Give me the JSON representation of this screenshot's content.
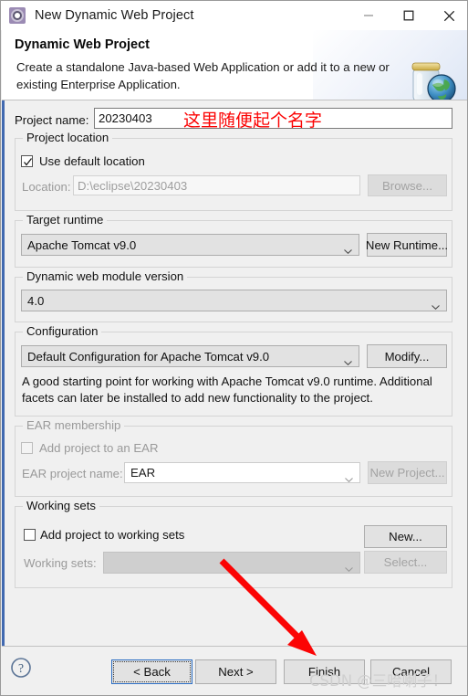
{
  "window": {
    "title": "New Dynamic Web Project",
    "icon": "eclipse-wizard-icon",
    "minimize_label": "—",
    "maximize_label": "□",
    "close_label": "✕"
  },
  "header": {
    "title": "Dynamic Web Project",
    "description": "Create a standalone Java-based Web Application or add it to a new or existing Enterprise Application.",
    "art_icon": "jar-globe-icon"
  },
  "form": {
    "project_name": {
      "label": "Project name:",
      "value": "20230403"
    },
    "project_location": {
      "group_label": "Project location",
      "use_default_checkbox": {
        "label": "Use default location",
        "checked": true
      },
      "location_label": "Location:",
      "location_value": "D:\\eclipse\\20230403",
      "browse_button": "Browse...",
      "disabled": true
    },
    "target_runtime": {
      "group_label": "Target runtime",
      "value": "Apache Tomcat v9.0",
      "new_runtime_button": "New Runtime..."
    },
    "module_version": {
      "group_label": "Dynamic web module version",
      "value": "4.0"
    },
    "configuration": {
      "group_label": "Configuration",
      "value": "Default Configuration for Apache Tomcat v9.0",
      "modify_button": "Modify...",
      "description": "A good starting point for working with Apache Tomcat v9.0 runtime. Additional facets can later be installed to add new functionality to the project."
    },
    "ear_membership": {
      "group_label": "EAR membership",
      "add_checkbox": {
        "label": "Add project to an EAR",
        "checked": false
      },
      "ear_name_label": "EAR project name:",
      "ear_name_value": "EAR",
      "new_project_button": "New Project...",
      "disabled": true
    },
    "working_sets": {
      "group_label": "Working sets",
      "add_checkbox": {
        "label": "Add project to working sets",
        "checked": false
      },
      "new_button": "New...",
      "working_sets_label": "Working sets:",
      "working_sets_value": "",
      "select_button": "Select...",
      "disabled": true
    }
  },
  "footer": {
    "help_icon": "question-mark-icon",
    "back_button": "< Back",
    "next_button": "Next >",
    "finish_button": "Finish",
    "cancel_button": "Cancel"
  },
  "annotations": {
    "name_hint": "这里随便起个名字",
    "arrow_color": "#fb0404",
    "watermark": "CSDN @三哈喇子！"
  }
}
